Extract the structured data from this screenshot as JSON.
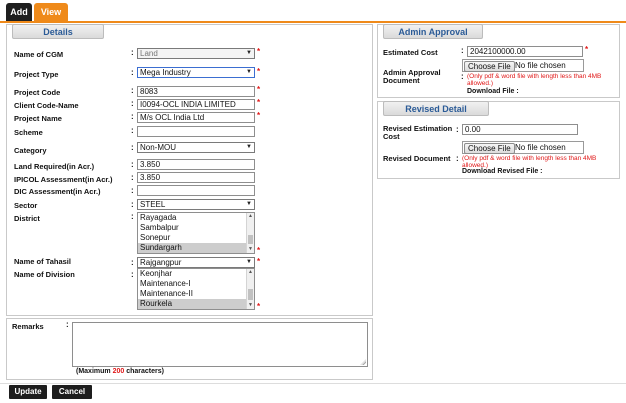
{
  "tabs": [
    {
      "label": "Add"
    },
    {
      "label": "View"
    }
  ],
  "details": {
    "header": "Details",
    "fields": {
      "cgm": {
        "label": "Name of CGM",
        "value": "Land"
      },
      "project_type": {
        "label": "Project Type",
        "value": "Mega Industry"
      },
      "project_code": {
        "label": "Project Code",
        "value": "8083"
      },
      "client_code": {
        "label": "Client Code-Name",
        "value": "I0094-OCL  INDIA LIMITED"
      },
      "project_name": {
        "label": "Project Name",
        "value": "M/s OCL India Ltd"
      },
      "scheme": {
        "label": "Scheme",
        "value": ""
      },
      "category": {
        "label": "Category",
        "value": "Non-MOU"
      },
      "land_required": {
        "label": "Land Required(in Acr.)",
        "value": "3.850"
      },
      "ipicol": {
        "label": "IPICOL Assessment(in Acr.)",
        "value": "3.850"
      },
      "dic": {
        "label": "DIC Assessment(in Acr.)",
        "value": ""
      },
      "sector": {
        "label": "Sector",
        "value": "STEEL"
      },
      "district": {
        "label": "District",
        "options": [
          "Rayagada",
          "Sambalpur",
          "Sonepur",
          "Sundargarh"
        ],
        "selected": "Sundargarh"
      },
      "tahasil": {
        "label": "Name of Tahasil",
        "value": "Rajgangpur"
      },
      "division": {
        "label": "Name of Division",
        "options": [
          "Keonjhar",
          "Maintenance-I",
          "Maintenance-II",
          "Rourkela"
        ],
        "selected": "Rourkela"
      }
    }
  },
  "remarks": {
    "label": "Remarks",
    "value": "",
    "note_prefix": "(Maximum ",
    "note_max": "200",
    "note_suffix": " characters)"
  },
  "admin_approval": {
    "header": "Admin Approval",
    "estimated_cost_label": "Estimated Cost",
    "estimated_cost_value": "2042100000.00",
    "document_label": "Admin Approval Document",
    "choose_file": "Choose File",
    "no_file": "No file chosen",
    "file_note": "(Only pdf & word file with length less than 4MB allowed.)",
    "download_label": "Download File :"
  },
  "revised_detail": {
    "header": "Revised Detail",
    "revised_cost_label": "Revised Estimation Cost",
    "revised_cost_value": "0.00",
    "document_label": "Revised Document",
    "choose_file": "Choose File",
    "no_file": "No file chosen",
    "file_note": "(Only pdf & word file with length less than 4MB allowed.)",
    "download_label": "Download Revised File :"
  },
  "buttons": {
    "update": "Update",
    "cancel": "Cancel"
  },
  "colors": {
    "accent": "#ef8a1a",
    "header_text": "#2b5b97",
    "required": "#e01818"
  }
}
